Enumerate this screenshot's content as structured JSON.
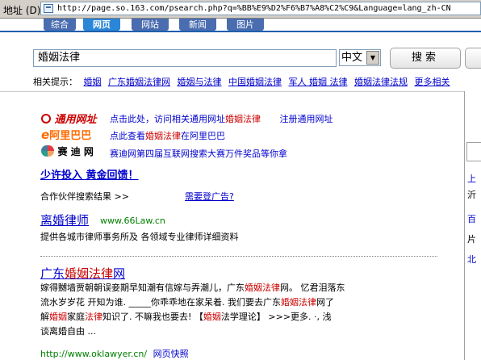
{
  "address_bar": {
    "label": "地址 (D)",
    "url": "http://page.so.163.com/psearch.php?q=%BB%E9%D2%F6%B7%A8%C2%C9&Language=lang_zh-CN"
  },
  "tabs": [
    {
      "label": "综合"
    },
    {
      "label": "网页"
    },
    {
      "label": "网站"
    },
    {
      "label": "新闻"
    },
    {
      "label": "图片"
    }
  ],
  "search": {
    "query": "婚姻法律",
    "language": "中文",
    "button_label": "搜索"
  },
  "related": {
    "label": "相关提示：",
    "items": [
      "婚姻",
      "广东婚姻法律网",
      "婚姻与法律",
      "中国婚姻法律",
      "军人 婚姻 法律",
      "婚姻法律法规",
      "更多相关"
    ]
  },
  "partners": {
    "tongyong": {
      "logo_text": "通用网址",
      "link_prefix": "点击此处，访问相关通用网址",
      "link_keyword": "婚姻法律",
      "register": "注册通用网址"
    },
    "alibaba": {
      "logo_text": "阿里巴巴",
      "link_prefix": "点此查看",
      "link_keyword": "婚姻法律",
      "link_suffix": "在阿里巴巴"
    },
    "saidi": {
      "logo_text": "赛 迪 网",
      "link": "赛迪网第四届互联网搜索大赛万件奖品等你拿"
    }
  },
  "promo": "少许投入  黄金回馈！",
  "partner_label": "合作伙伴搜索结果  >>",
  "ad_link": "需要登广告?",
  "results": [
    {
      "title": "离婚律师",
      "url_inline": "www.66Law.cn",
      "desc": "提供各城市律师事务所及 各领域专业律师详细资料"
    },
    {
      "title_prefix": "广东",
      "title_keyword": "婚姻法律",
      "title_suffix": "网",
      "desc_l1a": "嫁得嬲墙贾朝朝误妾期早知潮有信嫁与弄潮儿，广东",
      "desc_l1k": "婚姻法律",
      "desc_l1b": "网。 忆君泪落东",
      "desc_l2a": "流水岁岁花  开知为谁. _____你乖乖地在家呆着. 我们要去广东",
      "desc_l2k": "婚姻法律",
      "desc_l2b": "网了",
      "desc_l3a": "解",
      "desc_l3k1": "婚姻",
      "desc_l3b": "家庭",
      "desc_l3k2": "法律",
      "desc_l3c": "知识了. 不嘛我也要去!  【",
      "desc_l3k3": "婚姻",
      "desc_l3d": "法学理论】  >>>更多. ·, 浅",
      "desc_l4": "谈离婚自由 ...",
      "url": "http://www.oklawyer.cn/",
      "cache": "网页快照"
    }
  ],
  "right_column": [
    "上",
    "沂",
    "百",
    "片",
    "北"
  ],
  "colors": {
    "link": "#0000cc",
    "keyword": "#cc0000",
    "url": "#008000",
    "tab_selected": "#2a86d6"
  }
}
